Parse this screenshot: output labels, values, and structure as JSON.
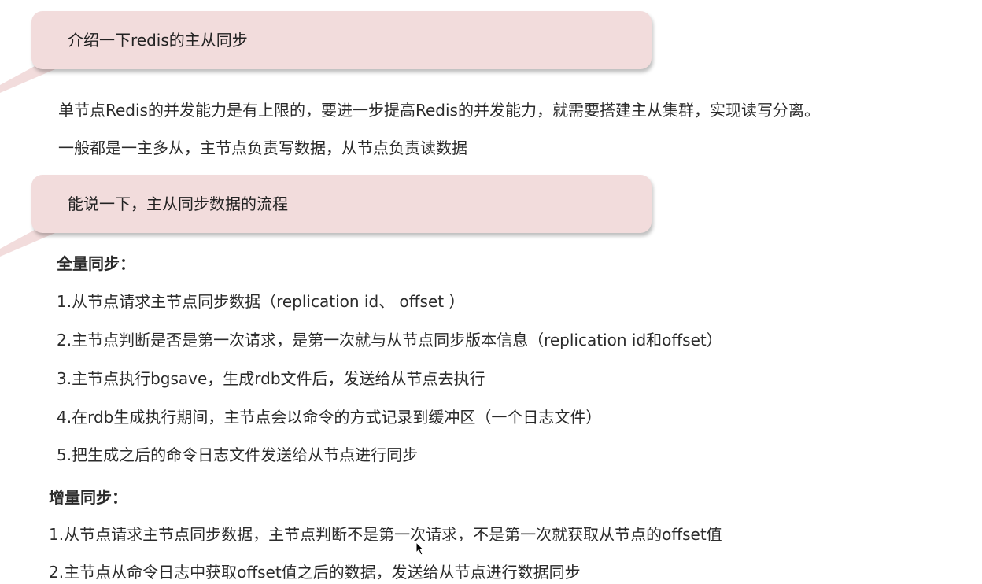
{
  "q1": "介绍一下redis的主从同步",
  "a1": [
    "单节点Redis的并发能力是有上限的，要进一步提高Redis的并发能力，就需要搭建主从集群，实现读写分离。",
    "一般都是一主多从，主节点负责写数据，从节点负责读数据"
  ],
  "q2": "能说一下，主从同步数据的流程",
  "full_sync": {
    "title": "全量同步：",
    "steps": [
      "1.从节点请求主节点同步数据（replication id、 offset ）",
      "2.主节点判断是否是第一次请求，是第一次就与从节点同步版本信息（replication id和offset）",
      "3.主节点执行bgsave，生成rdb文件后，发送给从节点去执行",
      "4.在rdb生成执行期间，主节点会以命令的方式记录到缓冲区（一个日志文件）",
      "5.把生成之后的命令日志文件发送给从节点进行同步"
    ]
  },
  "incr_sync": {
    "title": "增量同步：",
    "steps": [
      "1.从节点请求主节点同步数据，主节点判断不是第一次请求，不是第一次就获取从节点的offset值",
      "2.主节点从命令日志中获取offset值之后的数据，发送给从节点进行数据同步"
    ]
  },
  "colors": {
    "bubble": "#f2dcdc",
    "text": "#2b2b2b"
  }
}
